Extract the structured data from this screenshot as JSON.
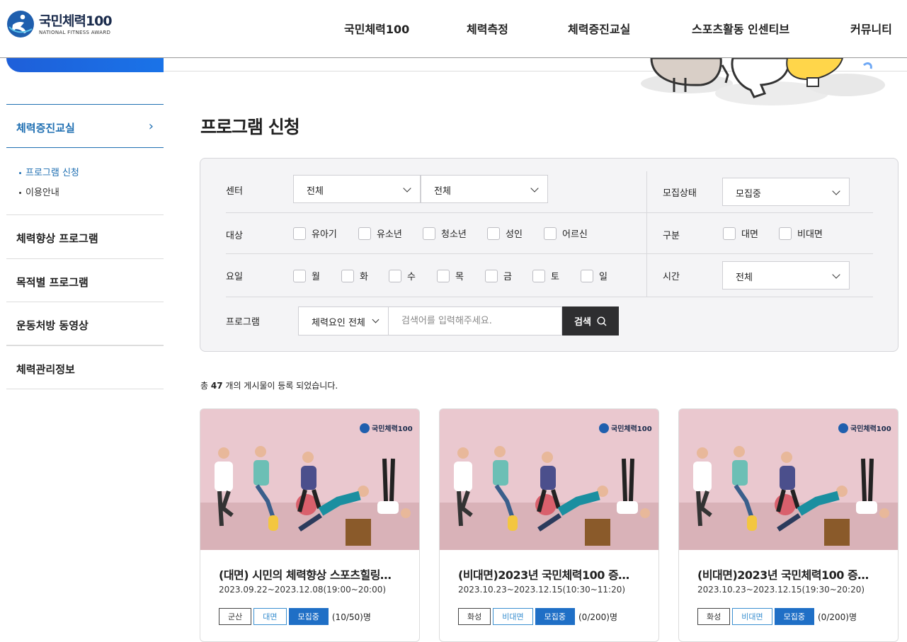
{
  "header": {
    "logo_title": "국민체력100",
    "logo_sub": "NATIONAL FITNESS AWARD",
    "nav": [
      "국민체력100",
      "체력측정",
      "체력증진교실",
      "스포츠활동 인센티브",
      "커뮤니티"
    ]
  },
  "sidebar": {
    "section": "체력증진교실",
    "sub_items": [
      "프로그램 신청",
      "이용안내"
    ],
    "items": [
      "체력향상 프로그램",
      "목적별 프로그램",
      "운동처방 동영상",
      "체력관리정보"
    ]
  },
  "page_title": "프로그램 신청",
  "filter": {
    "center_label": "센터",
    "center_select1": "전체",
    "center_select2": "전체",
    "recruit_label": "모집상태",
    "recruit_value": "모집중",
    "target_label": "대상",
    "targets": [
      "유아기",
      "유소년",
      "청소년",
      "성인",
      "어르신"
    ],
    "type_label": "구분",
    "types": [
      "대면",
      "비대면"
    ],
    "day_label": "요일",
    "days": [
      "월",
      "화",
      "수",
      "목",
      "금",
      "토",
      "일"
    ],
    "time_label": "시간",
    "time_value": "전체",
    "program_label": "프로그램",
    "program_select": "체력요인 전체",
    "search_placeholder": "검색어를 입력해주세요.",
    "search_button": "검색"
  },
  "count": {
    "prefix": "총",
    "num": "47",
    "suffix": "개의 게시물이 등록 되었습니다."
  },
  "cards": [
    {
      "brand": "국민체력100",
      "title": "(대면) 시민의 체력향상 스포츠힐링…",
      "date": "2023.09.22~2023.12.08(19:00~20:00)",
      "region": "군산",
      "mode": "대면",
      "status": "모집중",
      "capacity": "(10/50)명"
    },
    {
      "brand": "국민체력100",
      "title": "(비대면)2023년 국민체력100 증…",
      "date": "2023.10.23~2023.12.15(10:30~11:20)",
      "region": "화성",
      "mode": "비대면",
      "status": "모집중",
      "capacity": "(0/200)명"
    },
    {
      "brand": "국민체력100",
      "title": "(비대면)2023년 국민체력100 증…",
      "date": "2023.10.23~2023.12.15(19:30~20:20)",
      "region": "화성",
      "mode": "비대면",
      "status": "모집중",
      "capacity": "(0/200)명"
    }
  ],
  "colors": {
    "accent": "#1f6fb2",
    "status_badge": "#1f6fc6",
    "card_bg": "#eac8cf"
  }
}
